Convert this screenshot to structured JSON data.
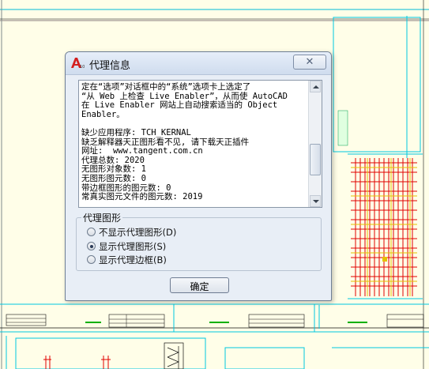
{
  "dialog": {
    "title": "代理信息",
    "close_symbol": "✕",
    "message_lines": [
      "定在“选项”对话框中的“系统”选项卡上选定了",
      "“从 Web 上检查 Live Enabler”，从而使 AutoCAD",
      "在 Live Enabler 网站上自动搜索适当的 Object",
      "Enabler。",
      "",
      "缺少应用程序: TCH_KERNAL",
      "缺乏解释器天正图形看不见, 请下载天正插件",
      "网址:  www.tangent.com.cn",
      "代理总数: 2020",
      "无图形对象数: 1",
      "无图形图元数: 0",
      "带边框图形的图元数: 0",
      "常真实图元文件的图元数: 2019"
    ],
    "group_label": "代理图形",
    "options": [
      {
        "label": "不显示代理图形(D)",
        "selected": false
      },
      {
        "label": "显示代理图形(S)",
        "selected": true
      },
      {
        "label": "显示代理边框(B)",
        "selected": false
      }
    ],
    "ok_label": "确定"
  }
}
